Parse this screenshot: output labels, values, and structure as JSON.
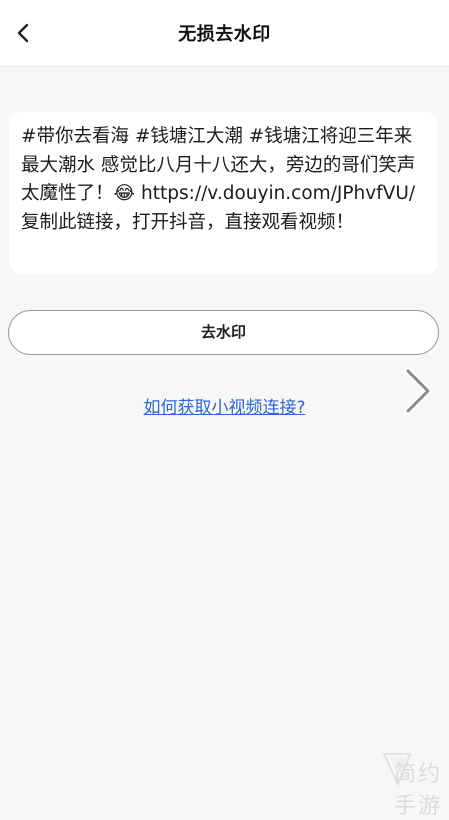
{
  "header": {
    "title": "无损去水印",
    "back_icon": "chevron-left-icon"
  },
  "share": {
    "text": "#带你去看海 #钱塘江大潮 #钱塘江将迎三年来最大潮水 感觉比八月十八还大，旁边的哥们笑声太魔性了！😂 https://v.douyin.com/JPhvfVU/ 复制此链接，打开抖音，直接观看视频！"
  },
  "action": {
    "remove_watermark_label": "去水印"
  },
  "help": {
    "link_label": "如何获取小视频连接?"
  },
  "navigation": {
    "next_icon": "chevron-right-icon"
  },
  "watermark": {
    "text": "简约手游"
  },
  "colors": {
    "background": "#f7f7f7",
    "card": "#ffffff",
    "link": "#2b66d6",
    "button_border": "#9a9a9a"
  }
}
